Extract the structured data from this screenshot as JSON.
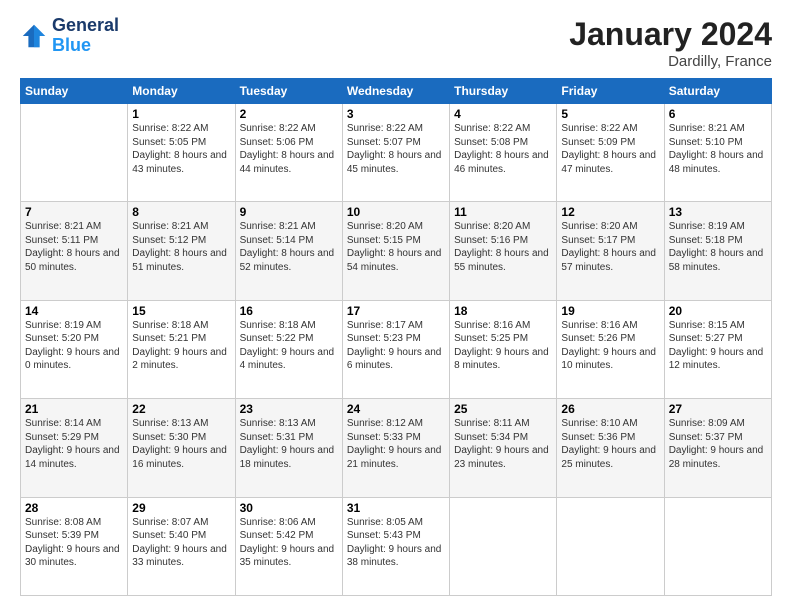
{
  "header": {
    "logo_line1": "General",
    "logo_line2": "Blue",
    "month_title": "January 2024",
    "location": "Dardilly, France"
  },
  "weekdays": [
    "Sunday",
    "Monday",
    "Tuesday",
    "Wednesday",
    "Thursday",
    "Friday",
    "Saturday"
  ],
  "weeks": [
    [
      {
        "day": "",
        "sunrise": "",
        "sunset": "",
        "daylight": ""
      },
      {
        "day": "1",
        "sunrise": "Sunrise: 8:22 AM",
        "sunset": "Sunset: 5:05 PM",
        "daylight": "Daylight: 8 hours and 43 minutes."
      },
      {
        "day": "2",
        "sunrise": "Sunrise: 8:22 AM",
        "sunset": "Sunset: 5:06 PM",
        "daylight": "Daylight: 8 hours and 44 minutes."
      },
      {
        "day": "3",
        "sunrise": "Sunrise: 8:22 AM",
        "sunset": "Sunset: 5:07 PM",
        "daylight": "Daylight: 8 hours and 45 minutes."
      },
      {
        "day": "4",
        "sunrise": "Sunrise: 8:22 AM",
        "sunset": "Sunset: 5:08 PM",
        "daylight": "Daylight: 8 hours and 46 minutes."
      },
      {
        "day": "5",
        "sunrise": "Sunrise: 8:22 AM",
        "sunset": "Sunset: 5:09 PM",
        "daylight": "Daylight: 8 hours and 47 minutes."
      },
      {
        "day": "6",
        "sunrise": "Sunrise: 8:21 AM",
        "sunset": "Sunset: 5:10 PM",
        "daylight": "Daylight: 8 hours and 48 minutes."
      }
    ],
    [
      {
        "day": "7",
        "sunrise": "Sunrise: 8:21 AM",
        "sunset": "Sunset: 5:11 PM",
        "daylight": "Daylight: 8 hours and 50 minutes."
      },
      {
        "day": "8",
        "sunrise": "Sunrise: 8:21 AM",
        "sunset": "Sunset: 5:12 PM",
        "daylight": "Daylight: 8 hours and 51 minutes."
      },
      {
        "day": "9",
        "sunrise": "Sunrise: 8:21 AM",
        "sunset": "Sunset: 5:14 PM",
        "daylight": "Daylight: 8 hours and 52 minutes."
      },
      {
        "day": "10",
        "sunrise": "Sunrise: 8:20 AM",
        "sunset": "Sunset: 5:15 PM",
        "daylight": "Daylight: 8 hours and 54 minutes."
      },
      {
        "day": "11",
        "sunrise": "Sunrise: 8:20 AM",
        "sunset": "Sunset: 5:16 PM",
        "daylight": "Daylight: 8 hours and 55 minutes."
      },
      {
        "day": "12",
        "sunrise": "Sunrise: 8:20 AM",
        "sunset": "Sunset: 5:17 PM",
        "daylight": "Daylight: 8 hours and 57 minutes."
      },
      {
        "day": "13",
        "sunrise": "Sunrise: 8:19 AM",
        "sunset": "Sunset: 5:18 PM",
        "daylight": "Daylight: 8 hours and 58 minutes."
      }
    ],
    [
      {
        "day": "14",
        "sunrise": "Sunrise: 8:19 AM",
        "sunset": "Sunset: 5:20 PM",
        "daylight": "Daylight: 9 hours and 0 minutes."
      },
      {
        "day": "15",
        "sunrise": "Sunrise: 8:18 AM",
        "sunset": "Sunset: 5:21 PM",
        "daylight": "Daylight: 9 hours and 2 minutes."
      },
      {
        "day": "16",
        "sunrise": "Sunrise: 8:18 AM",
        "sunset": "Sunset: 5:22 PM",
        "daylight": "Daylight: 9 hours and 4 minutes."
      },
      {
        "day": "17",
        "sunrise": "Sunrise: 8:17 AM",
        "sunset": "Sunset: 5:23 PM",
        "daylight": "Daylight: 9 hours and 6 minutes."
      },
      {
        "day": "18",
        "sunrise": "Sunrise: 8:16 AM",
        "sunset": "Sunset: 5:25 PM",
        "daylight": "Daylight: 9 hours and 8 minutes."
      },
      {
        "day": "19",
        "sunrise": "Sunrise: 8:16 AM",
        "sunset": "Sunset: 5:26 PM",
        "daylight": "Daylight: 9 hours and 10 minutes."
      },
      {
        "day": "20",
        "sunrise": "Sunrise: 8:15 AM",
        "sunset": "Sunset: 5:27 PM",
        "daylight": "Daylight: 9 hours and 12 minutes."
      }
    ],
    [
      {
        "day": "21",
        "sunrise": "Sunrise: 8:14 AM",
        "sunset": "Sunset: 5:29 PM",
        "daylight": "Daylight: 9 hours and 14 minutes."
      },
      {
        "day": "22",
        "sunrise": "Sunrise: 8:13 AM",
        "sunset": "Sunset: 5:30 PM",
        "daylight": "Daylight: 9 hours and 16 minutes."
      },
      {
        "day": "23",
        "sunrise": "Sunrise: 8:13 AM",
        "sunset": "Sunset: 5:31 PM",
        "daylight": "Daylight: 9 hours and 18 minutes."
      },
      {
        "day": "24",
        "sunrise": "Sunrise: 8:12 AM",
        "sunset": "Sunset: 5:33 PM",
        "daylight": "Daylight: 9 hours and 21 minutes."
      },
      {
        "day": "25",
        "sunrise": "Sunrise: 8:11 AM",
        "sunset": "Sunset: 5:34 PM",
        "daylight": "Daylight: 9 hours and 23 minutes."
      },
      {
        "day": "26",
        "sunrise": "Sunrise: 8:10 AM",
        "sunset": "Sunset: 5:36 PM",
        "daylight": "Daylight: 9 hours and 25 minutes."
      },
      {
        "day": "27",
        "sunrise": "Sunrise: 8:09 AM",
        "sunset": "Sunset: 5:37 PM",
        "daylight": "Daylight: 9 hours and 28 minutes."
      }
    ],
    [
      {
        "day": "28",
        "sunrise": "Sunrise: 8:08 AM",
        "sunset": "Sunset: 5:39 PM",
        "daylight": "Daylight: 9 hours and 30 minutes."
      },
      {
        "day": "29",
        "sunrise": "Sunrise: 8:07 AM",
        "sunset": "Sunset: 5:40 PM",
        "daylight": "Daylight: 9 hours and 33 minutes."
      },
      {
        "day": "30",
        "sunrise": "Sunrise: 8:06 AM",
        "sunset": "Sunset: 5:42 PM",
        "daylight": "Daylight: 9 hours and 35 minutes."
      },
      {
        "day": "31",
        "sunrise": "Sunrise: 8:05 AM",
        "sunset": "Sunset: 5:43 PM",
        "daylight": "Daylight: 9 hours and 38 minutes."
      },
      {
        "day": "",
        "sunrise": "",
        "sunset": "",
        "daylight": ""
      },
      {
        "day": "",
        "sunrise": "",
        "sunset": "",
        "daylight": ""
      },
      {
        "day": "",
        "sunrise": "",
        "sunset": "",
        "daylight": ""
      }
    ]
  ]
}
